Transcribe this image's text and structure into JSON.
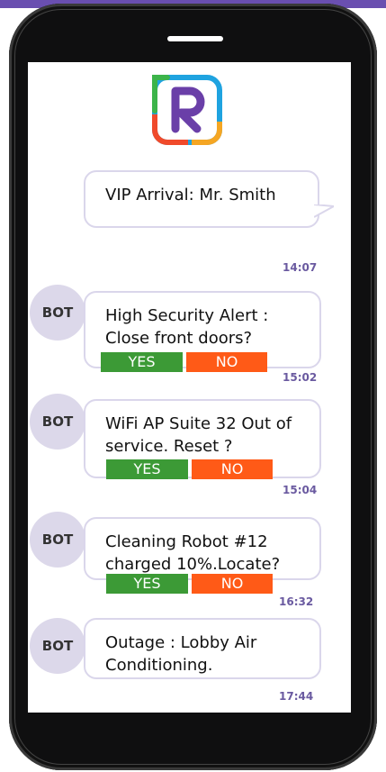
{
  "messages": [
    {
      "text": "VIP Arrival: Mr. Smith",
      "time": "14:07"
    },
    {
      "sender": "BOT",
      "text": "High Security Alert : Close front doors?",
      "time": "15:02",
      "yes": "YES",
      "no": "NO"
    },
    {
      "sender": "BOT",
      "text": "WiFi AP Suite 32 Out of service. Reset ?",
      "time": "15:04",
      "yes": "YES",
      "no": "NO"
    },
    {
      "sender": "BOT",
      "text": "Cleaning Robot #12 charged 10%.Locate?",
      "time": "16:32",
      "yes": "YES",
      "no": "NO"
    },
    {
      "sender": "BOT",
      "text": "Outage : Lobby Air Conditioning.",
      "time": "17:44"
    }
  ],
  "colors": {
    "brand": "#6a4fb0",
    "yes": "#3c9a36",
    "no": "#ff5a17",
    "bubble_border": "#dad6eb",
    "avatar": "#dcd8ea"
  },
  "logo_icon": "r-brand-logo-icon"
}
